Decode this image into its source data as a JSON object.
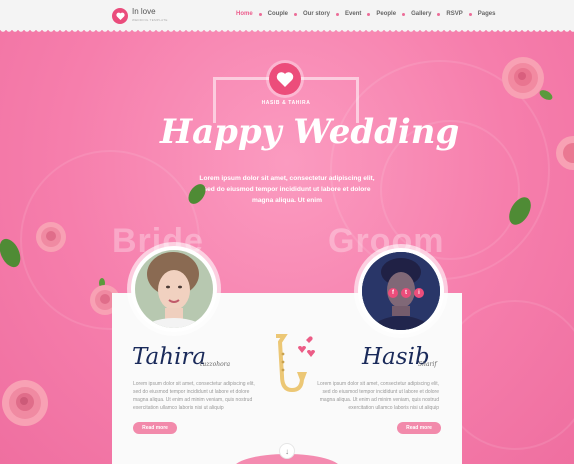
{
  "header": {
    "logo_text": "In love",
    "logo_sub": "WEDDING TEMPLATE",
    "nav": [
      {
        "label": "Home"
      },
      {
        "label": "Couple"
      },
      {
        "label": "Our story"
      },
      {
        "label": "Event"
      },
      {
        "label": "People"
      },
      {
        "label": "Gallery"
      },
      {
        "label": "RSVP"
      },
      {
        "label": "Pages"
      }
    ]
  },
  "hero": {
    "names": "HASIB & TAHIRA",
    "title": "Happy Wedding",
    "text": "Lorem ipsum dolor sit amet, consectetur adipiscing elit, sed do eiusmod tempor incididunt ut labore et dolore magna aliqua. Ut enim"
  },
  "ghost": {
    "bride": "Bride",
    "groom": "Groom"
  },
  "bride": {
    "name": "Tahira",
    "surname": "tuzzohora",
    "text": "Lorem ipsum dolor sit amet, consectetur adipiscing elit, sed do eiusmod tempor incididunt ut labore et dolore magna aliqua. Ut enim ad minim veniam, quis nostrud exercitation ullamco laboris nisi ut aliquip",
    "button": "Read more"
  },
  "groom": {
    "name": "Hasib",
    "surname": "Sharif",
    "text": "Lorem ipsum dolor sit amet, consectetur adipiscing elit, sed do eiusmod tempor incididunt ut labore et dolore magna aliqua. Ut enim ad minim veniam, quis nostrud exercitation ullamco laboris nisi ut aliquip",
    "button": "Read more",
    "social": [
      "f",
      "t",
      "i"
    ]
  },
  "colors": {
    "accent": "#ec4d7b",
    "background": "#f67eac",
    "name": "#1a2a5a"
  },
  "icons": [
    "heart-icon",
    "saxophone-icon",
    "chevron-down-icon",
    "facebook-icon",
    "twitter-icon",
    "instagram-icon"
  ]
}
